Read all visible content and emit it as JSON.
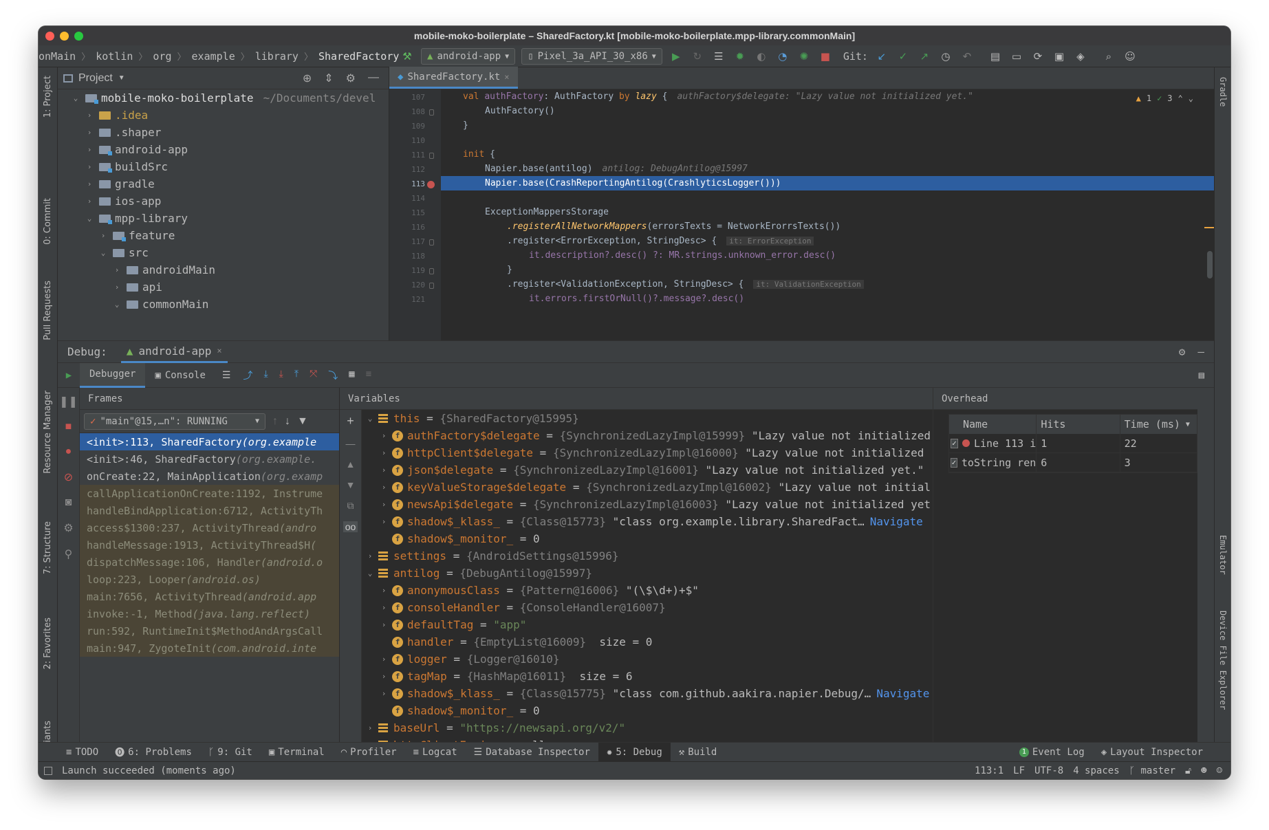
{
  "window": {
    "title": "mobile-moko-boilerplate – SharedFactory.kt [mobile-moko-boilerplate.mpp-library.commonMain]"
  },
  "navbar": {
    "crumbs": [
      "onMain",
      "kotlin",
      "org",
      "example",
      "library",
      "SharedFactory"
    ],
    "run_config": "android-app",
    "device": "Pixel_3a_API_30_x86",
    "git_label": "Git:"
  },
  "left_tabs": [
    "1: Project",
    "0: Commit",
    "Pull Requests",
    "Resource Manager",
    "7: Structure",
    "2: Favorites",
    "Variants"
  ],
  "right_tabs": [
    "Gradle",
    "Emulator",
    "Device File Explorer"
  ],
  "project": {
    "header": "Project",
    "tree": [
      {
        "name": "mobile-moko-boilerplate",
        "extra": "~/Documents/devel",
        "level": 0,
        "open": true,
        "mod": true
      },
      {
        "name": ".idea",
        "level": 1,
        "open": false,
        "color": "#c9a24a"
      },
      {
        "name": ".shaper",
        "level": 1,
        "open": false
      },
      {
        "name": "android-app",
        "level": 1,
        "open": false,
        "mod": true
      },
      {
        "name": "buildSrc",
        "level": 1,
        "open": false,
        "mod": true
      },
      {
        "name": "gradle",
        "level": 1,
        "open": false
      },
      {
        "name": "ios-app",
        "level": 1,
        "open": false
      },
      {
        "name": "mpp-library",
        "level": 1,
        "open": true,
        "mod": true
      },
      {
        "name": "feature",
        "level": 2,
        "open": false,
        "mod": true
      },
      {
        "name": "src",
        "level": 2,
        "open": true
      },
      {
        "name": "androidMain",
        "level": 3,
        "open": false
      },
      {
        "name": "api",
        "level": 3,
        "open": false
      },
      {
        "name": "commonMain",
        "level": 3,
        "open": true
      }
    ]
  },
  "editor": {
    "tab": "SharedFactory.kt",
    "warnings": "1",
    "oks": "3",
    "lines": [
      "107",
      "108",
      "109",
      "110",
      "111",
      "112",
      "113",
      "114",
      "115",
      "116",
      "117",
      "118",
      "119",
      "120",
      "121"
    ],
    "code": {
      "l107_decl": "val ",
      "l107_name": "authFactory",
      "l107_type": ": AuthFactory ",
      "l107_by": "by ",
      "l107_lazy": "lazy",
      "l107_brace": " {",
      "l107_hint": "authFactory$delegate: \"Lazy value not initialized yet.\"",
      "l108": "AuthFactory()",
      "l109": "}",
      "l111_init": "init",
      "l111_brace": " {",
      "l112": "Napier.base(antilog)",
      "l112_hint": "antilog: DebugAntilog@15997",
      "l113": "Napier.base(CrashReportingAntilog(CrashlyticsLogger()))",
      "l115": "ExceptionMappersStorage",
      "l116_fn": ".registerAllNetworkMappers",
      "l116_rest": "(errorsTexts = NetworkErorrsTexts())",
      "l117": ".register<ErrorException, StringDesc> {",
      "l117_hint": "it: ErrorException",
      "l118": "it.description?.desc() ?: MR.strings.unknown_error.desc()",
      "l119": "}",
      "l120": ".register<ValidationException, StringDesc> {",
      "l120_hint": "it: ValidationException",
      "l121": "it.errors.firstOrNull()?.message?.desc()"
    }
  },
  "debug": {
    "label": "Debug:",
    "config": "android-app",
    "tab_debugger": "Debugger",
    "tab_console": "Console",
    "frames_header": "Frames",
    "thread": "\"main\"@15,…n\": RUNNING",
    "frames": [
      {
        "m": "<init>:113, SharedFactory ",
        "p": "(org.example",
        "lib": false,
        "sel": true
      },
      {
        "m": "<init>:46, SharedFactory ",
        "p": "(org.example.",
        "lib": false
      },
      {
        "m": "onCreate:22, MainApplication ",
        "p": "(org.examp",
        "lib": false
      },
      {
        "m": "callApplicationOnCreate:1192, Instrume",
        "p": "",
        "lib": true
      },
      {
        "m": "handleBindApplication:6712, ActivityTh",
        "p": "",
        "lib": true
      },
      {
        "m": "access$1300:237, ActivityThread ",
        "p": "(andro",
        "lib": true
      },
      {
        "m": "handleMessage:1913, ActivityThread$H ",
        "p": "(",
        "lib": true
      },
      {
        "m": "dispatchMessage:106, Handler ",
        "p": "(android.o",
        "lib": true
      },
      {
        "m": "loop:223, Looper ",
        "p": "(android.os)",
        "lib": true
      },
      {
        "m": "main:7656, ActivityThread ",
        "p": "(android.app",
        "lib": true
      },
      {
        "m": "invoke:-1, Method ",
        "p": "(java.lang.reflect)",
        "lib": true
      },
      {
        "m": "run:592, RuntimeInit$MethodAndArgsCall",
        "p": "",
        "lib": true
      },
      {
        "m": "main:947, ZygoteInit ",
        "p": "(com.android.inte",
        "lib": true
      }
    ],
    "variables_header": "Variables",
    "variables": [
      {
        "lvl": 0,
        "exp": "open",
        "icon": "e",
        "name": "this",
        "eq": " = ",
        "type": "{SharedFactory@15995}",
        "val": ""
      },
      {
        "lvl": 1,
        "exp": "closed",
        "icon": "f",
        "name": "authFactory$delegate",
        "eq": " = ",
        "type": "{SynchronizedLazyImpl@15999}",
        "val": " \"Lazy value not initialized"
      },
      {
        "lvl": 1,
        "exp": "closed",
        "icon": "f",
        "name": "httpClient$delegate",
        "eq": " = ",
        "type": "{SynchronizedLazyImpl@16000}",
        "val": " \"Lazy value not initialized"
      },
      {
        "lvl": 1,
        "exp": "closed",
        "icon": "f",
        "name": "json$delegate",
        "eq": " = ",
        "type": "{SynchronizedLazyImpl@16001}",
        "val": " \"Lazy value not initialized yet.\""
      },
      {
        "lvl": 1,
        "exp": "closed",
        "icon": "f",
        "name": "keyValueStorage$delegate",
        "eq": " = ",
        "type": "{SynchronizedLazyImpl@16002}",
        "val": " \"Lazy value not initial"
      },
      {
        "lvl": 1,
        "exp": "closed",
        "icon": "f",
        "name": "newsApi$delegate",
        "eq": " = ",
        "type": "{SynchronizedLazyImpl@16003}",
        "val": " \"Lazy value not initialized yet"
      },
      {
        "lvl": 1,
        "exp": "closed",
        "icon": "f",
        "name": "shadow$_klass_",
        "eq": " = ",
        "type": "{Class@15773}",
        "val": " \"class org.example.library.SharedFact…",
        "nav": "Navigate"
      },
      {
        "lvl": 1,
        "exp": "none",
        "icon": "f",
        "name": "shadow$_monitor_",
        "eq": " = ",
        "type": "",
        "val": "0"
      },
      {
        "lvl": 0,
        "exp": "closed",
        "icon": "e",
        "name": "settings",
        "eq": " = ",
        "type": "{AndroidSettings@15996}",
        "val": ""
      },
      {
        "lvl": 0,
        "exp": "open",
        "icon": "e",
        "name": "antilog",
        "eq": " = ",
        "type": "{DebugAntilog@15997}",
        "val": ""
      },
      {
        "lvl": 1,
        "exp": "closed",
        "icon": "f",
        "name": "anonymousClass",
        "eq": " = ",
        "type": "{Pattern@16006}",
        "val": " \"(\\$\\d+)+$\""
      },
      {
        "lvl": 1,
        "exp": "closed",
        "icon": "f",
        "name": "consoleHandler",
        "eq": " = ",
        "type": "{ConsoleHandler@16007}",
        "val": ""
      },
      {
        "lvl": 1,
        "exp": "closed",
        "icon": "f",
        "name": "defaultTag",
        "eq": " = ",
        "type": "",
        "val": "\"app\"",
        "isstr": true
      },
      {
        "lvl": 1,
        "exp": "none",
        "icon": "f",
        "name": "handler",
        "eq": " = ",
        "type": "{EmptyList@16009}",
        "val": "  size = 0"
      },
      {
        "lvl": 1,
        "exp": "closed",
        "icon": "f",
        "name": "logger",
        "eq": " = ",
        "type": "{Logger@16010}",
        "val": ""
      },
      {
        "lvl": 1,
        "exp": "closed",
        "icon": "f",
        "name": "tagMap",
        "eq": " = ",
        "type": "{HashMap@16011}",
        "val": "  size = 6"
      },
      {
        "lvl": 1,
        "exp": "closed",
        "icon": "f",
        "name": "shadow$_klass_",
        "eq": " = ",
        "type": "{Class@15775}",
        "val": " \"class com.github.aakira.napier.Debug/…",
        "nav": "Navigate"
      },
      {
        "lvl": 1,
        "exp": "none",
        "icon": "f",
        "name": "shadow$_monitor_",
        "eq": " = ",
        "type": "",
        "val": "0"
      },
      {
        "lvl": 0,
        "exp": "closed",
        "icon": "e",
        "name": "baseUrl",
        "eq": " = ",
        "type": "",
        "val": "\"https://newsapi.org/v2/\"",
        "isstr": true
      },
      {
        "lvl": 0,
        "exp": "none",
        "icon": "e",
        "name": "httpClientEngine",
        "eq": " = ",
        "type": "",
        "val": "null"
      }
    ],
    "overhead": {
      "header": "Overhead",
      "columns": [
        "Name",
        "Hits",
        "Time (ms)"
      ],
      "rows": [
        {
          "name": "Line 113 i",
          "hits": "1",
          "time": "22",
          "bp": true
        },
        {
          "name": "toString ren",
          "hits": "6",
          "time": "3",
          "bp": false
        }
      ]
    }
  },
  "bottombar": {
    "items": [
      "TODO",
      "6: Problems",
      "9: Git",
      "Terminal",
      "Profiler",
      "Logcat",
      "Database Inspector",
      "5: Debug",
      "Build"
    ],
    "right": [
      "Event Log",
      "Layout Inspector"
    ],
    "event_count": "1"
  },
  "status": {
    "message": "Launch succeeded (moments ago)",
    "position": "113:1",
    "line_sep": "LF",
    "encoding": "UTF-8",
    "indent": "4 spaces",
    "branch": "master"
  },
  "colors": {
    "accent": "#4a88c7",
    "selection": "#2d5ea0",
    "keyword": "#cc7832",
    "string": "#6a8759",
    "function": "#ffc66d",
    "run_green": "#499c54",
    "stop_red": "#c75450"
  }
}
